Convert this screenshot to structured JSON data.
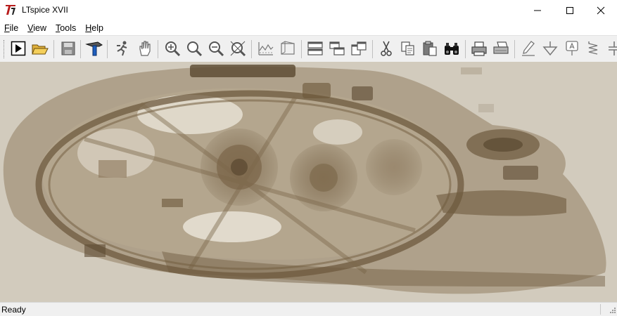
{
  "window": {
    "title": "LTspice XVII",
    "minimize_icon": "minimize-icon",
    "maximize_icon": "maximize-icon",
    "close_icon": "close-icon"
  },
  "menu": {
    "items": [
      {
        "label": "File",
        "accel": "F",
        "rest": "ile"
      },
      {
        "label": "View",
        "accel": "V",
        "rest": "iew"
      },
      {
        "label": "Tools",
        "accel": "T",
        "rest": "ools"
      },
      {
        "label": "Help",
        "accel": "H",
        "rest": "elp"
      }
    ]
  },
  "toolbar": {
    "buttons": [
      "run-icon",
      "open-icon",
      "save-icon",
      "control-panel-icon",
      "halt-icon",
      "pan-icon",
      "zoom-in-icon",
      "zoom-back-icon",
      "zoom-out-icon",
      "zoom-fit-icon",
      "autorange-icon",
      "mark-unused-icon",
      "tile-horizontal-icon",
      "cascade-icon",
      "tile-vertical-icon",
      "cut-icon",
      "copy-icon",
      "paste-icon",
      "find-icon",
      "print-icon",
      "print-preview-icon",
      "draw-wire-icon",
      "ground-icon",
      "label-net-icon",
      "resistor-icon",
      "capacitor-icon"
    ]
  },
  "canvas": {
    "background_color": "#cfc8b8",
    "ink_color": "#6e5a3e"
  },
  "status": {
    "text": "Ready"
  }
}
